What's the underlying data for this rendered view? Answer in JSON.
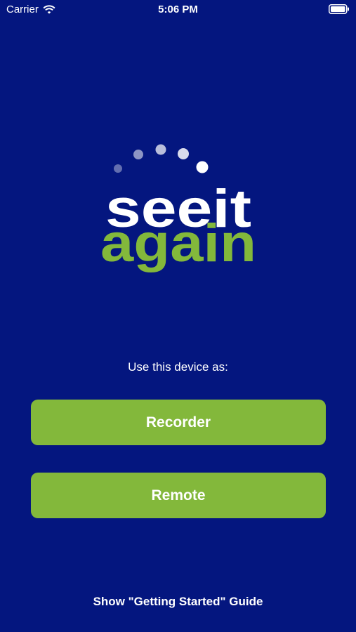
{
  "status_bar": {
    "carrier": "Carrier",
    "time": "5:06 PM",
    "wifi_icon": "wifi-icon",
    "battery_icon": "battery-icon"
  },
  "logo": {
    "line1": "seeit",
    "line2": "again",
    "colors": {
      "line1": "#ffffff",
      "line2": "#83b83b"
    }
  },
  "prompt": "Use this device as:",
  "buttons": {
    "recorder_label": "Recorder",
    "remote_label": "Remote"
  },
  "guide_link": "Show \"Getting Started\" Guide",
  "colors": {
    "background": "#04167f",
    "button": "#83b83b",
    "text": "#ffffff"
  }
}
